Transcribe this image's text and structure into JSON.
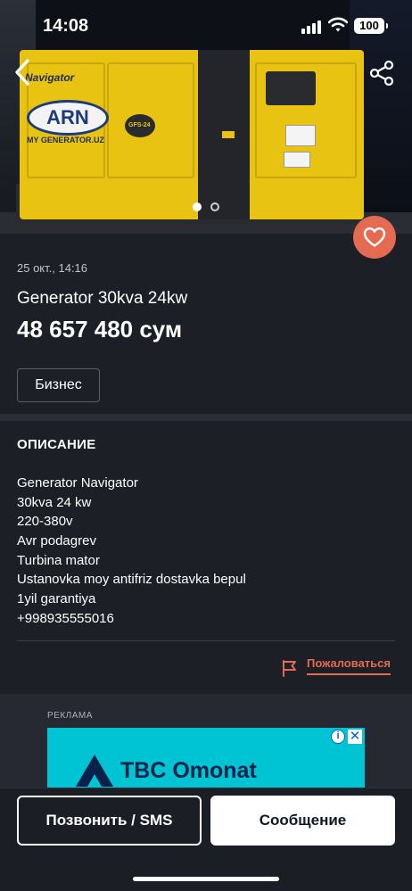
{
  "status_bar": {
    "time": "14:08",
    "battery": "100"
  },
  "hero": {
    "logo_text": "ARN",
    "brand_text": "Navigator",
    "site_text": "MY GENERATOR.UZ",
    "model_badge": "GFS-24",
    "carousel_total": 2,
    "carousel_active": 1
  },
  "listing": {
    "date": "25 окт., 14:16",
    "title": "Generator 30kva 24kw",
    "price": "48 657 480 сум",
    "tag": "Бизнес"
  },
  "description": {
    "heading": "ОПИСАНИЕ",
    "lines": [
      "Generator Navigator",
      "30kva 24 kw",
      "220-380v",
      "Avr podagrev",
      "Turbina mator",
      "Ustanovka moy antifriz dostavka bepul",
      "1yil garantiya",
      "+998935555016"
    ]
  },
  "report": {
    "label": "Пожаловаться"
  },
  "ad": {
    "caption": "РЕКЛАМА",
    "brand_text": "TBC Omonat",
    "info_symbol": "i",
    "close_symbol": "✕"
  },
  "actions": {
    "call_label": "Позвонить / SMS",
    "message_label": "Сообщение"
  },
  "colors": {
    "accent": "#e46b52",
    "background": "#1c1f26",
    "ad_background": "#00c3d3"
  },
  "icons": {
    "back": "chevron-left-icon",
    "share": "share-icon",
    "favorite": "heart-icon",
    "report": "flag-icon",
    "ad_logo": "tbc-logo-icon"
  }
}
